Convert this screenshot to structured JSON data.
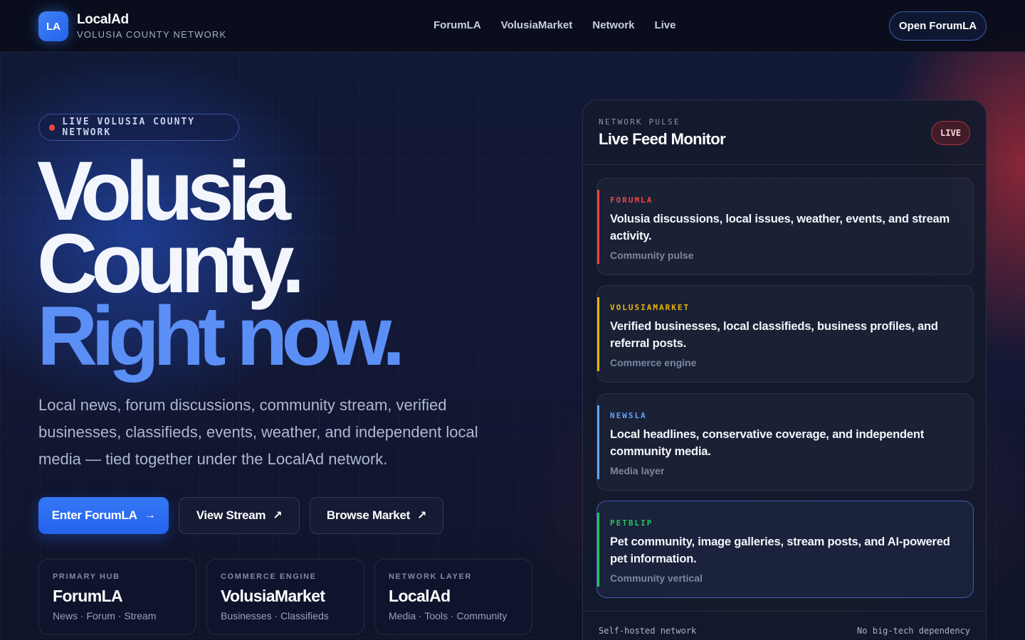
{
  "brand": {
    "badge": "LA",
    "name": "LocalAd",
    "subtitle": "VOLUSIA COUNTY NETWORK"
  },
  "nav": {
    "items": [
      "ForumLA",
      "VolusiaMarket",
      "Network",
      "Live"
    ],
    "cta": "Open ForumLA"
  },
  "hero": {
    "pill": "LIVE VOLUSIA COUNTY NETWORK",
    "title_line1": "Volusia",
    "title_line2": "County.",
    "title_line3": "Right now.",
    "description": "Local news, forum discussions, community stream, verified businesses, classifieds, events, weather, and independent local media — tied together under the LocalAd network.",
    "buttons": {
      "enter": "Enter ForumLA",
      "stream": "View Stream",
      "market": "Browse Market"
    }
  },
  "cards": [
    {
      "label": "PRIMARY HUB",
      "title": "ForumLA",
      "sub": "News · Forum · Stream"
    },
    {
      "label": "COMMERCE ENGINE",
      "title": "VolusiaMarket",
      "sub": "Businesses · Classifieds"
    },
    {
      "label": "NETWORK LAYER",
      "title": "LocalAd",
      "sub": "Media · Tools · Community"
    }
  ],
  "panel": {
    "kicker": "NETWORK PULSE",
    "title": "Live Feed Monitor",
    "badge": "LIVE",
    "feeds": [
      {
        "tag": "FORUMLA",
        "body": "Volusia discussions, local issues, weather, events, and stream activity.",
        "meta": "Community pulse",
        "color": "#ef4444"
      },
      {
        "tag": "VOLUSIAMARKET",
        "body": "Verified businesses, local classifieds, business profiles, and referral posts.",
        "meta": "Commerce engine",
        "color": "#eab308"
      },
      {
        "tag": "NEWSLA",
        "body": "Local headlines, conservative coverage, and independent community media.",
        "meta": "Media layer",
        "color": "#60a5fa"
      },
      {
        "tag": "PETBLIP",
        "body": "Pet community, image galleries, stream posts, and AI-powered pet information.",
        "meta": "Community vertical",
        "color": "#22c55e"
      }
    ],
    "footer_left": "Self-hosted network",
    "footer_right": "No big-tech dependency"
  }
}
